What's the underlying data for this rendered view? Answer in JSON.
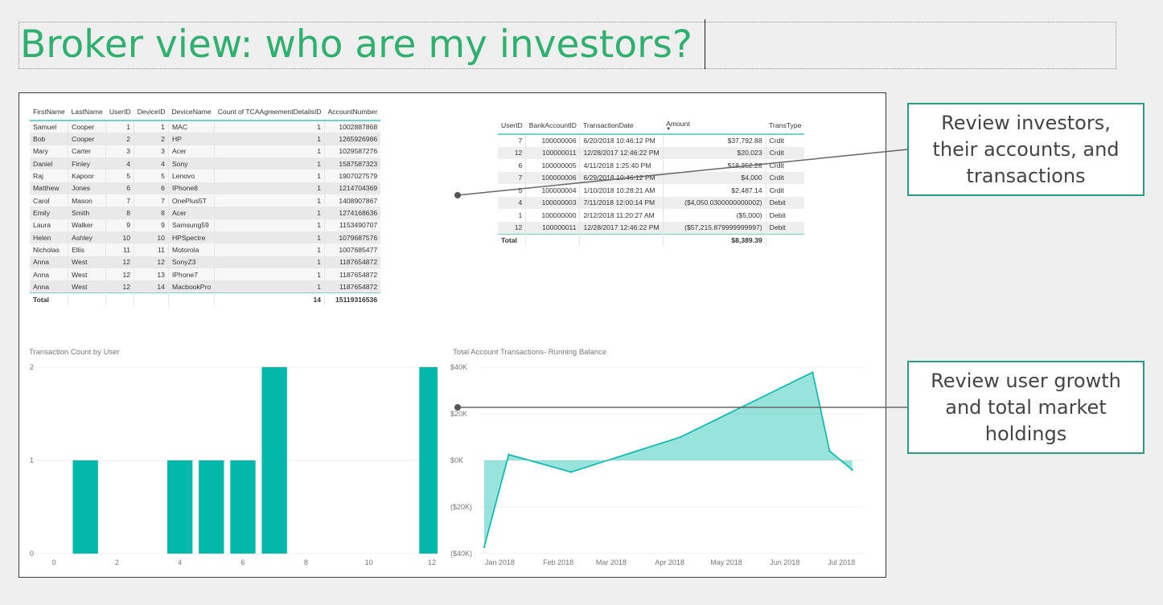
{
  "slide": {
    "title": "Broker view: who are my investors?"
  },
  "investors_table": {
    "columns": [
      "FirstName",
      "LastName",
      "UserID",
      "DeviceID",
      "DeviceName",
      "Count of TCAAgreementDetailsID",
      "AccountNumber"
    ],
    "rows": [
      [
        "Samuel",
        "Cooper",
        "1",
        "1",
        "MAC",
        "1",
        "1002887868"
      ],
      [
        "Bob",
        "Cooper",
        "2",
        "2",
        "HP",
        "1",
        "1265926986"
      ],
      [
        "Mary",
        "Carter",
        "3",
        "3",
        "Acer",
        "1",
        "1029587276"
      ],
      [
        "Daniel",
        "Finley",
        "4",
        "4",
        "Sony",
        "1",
        "1587587323"
      ],
      [
        "Raj",
        "Kapoor",
        "5",
        "5",
        "Lenovo",
        "1",
        "1907027579"
      ],
      [
        "Matthew",
        "Jones",
        "6",
        "6",
        "IPhone8",
        "1",
        "1214704369"
      ],
      [
        "Carol",
        "Mason",
        "7",
        "7",
        "OnePlus5T",
        "1",
        "1408907867"
      ],
      [
        "Emily",
        "Smith",
        "8",
        "8",
        "Acer",
        "1",
        "1274168636"
      ],
      [
        "Laura",
        "Walker",
        "9",
        "9",
        "Samsung59",
        "1",
        "1153490707"
      ],
      [
        "Helen",
        "Ashley",
        "10",
        "10",
        "HPSpectre",
        "1",
        "1079687576"
      ],
      [
        "Nicholas",
        "Ellis",
        "11",
        "11",
        "Motorola",
        "1",
        "1007685477"
      ],
      [
        "Anna",
        "West",
        "12",
        "12",
        "SonyZ3",
        "1",
        "1187654872"
      ],
      [
        "Anna",
        "West",
        "12",
        "13",
        "IPhone7",
        "1",
        "1187654872"
      ],
      [
        "Anna",
        "West",
        "12",
        "14",
        "MacbookPro",
        "1",
        "1187654872"
      ]
    ],
    "total": {
      "label": "Total",
      "count": "14",
      "account": "15119316536"
    }
  },
  "transactions_table": {
    "columns": [
      "UserID",
      "BankAccountID",
      "TransactionDate",
      "Amount",
      "TransType"
    ],
    "rows": [
      [
        "7",
        "100000006",
        "6/20/2018 10:46:12 PM",
        "$37,792.88",
        "Crdit"
      ],
      [
        "12",
        "100000011",
        "12/28/2017 12:46:22 PM",
        "$20,023",
        "Crdit"
      ],
      [
        "6",
        "100000005",
        "4/11/2018 1:25:40 PM",
        "$18,352.28",
        "Crdit"
      ],
      [
        "7",
        "100000006",
        "6/29/2018 10:46:12 PM",
        "$4,000",
        "Crdit"
      ],
      [
        "5",
        "100000004",
        "1/10/2018 10:28:21 AM",
        "$2,487.14",
        "Crdit"
      ],
      [
        "4",
        "100000003",
        "7/11/2018 12:00:14 PM",
        "($4,050.0300000000002)",
        "Debit"
      ],
      [
        "1",
        "100000000",
        "2/12/2018 11:20:27 AM",
        "($5,000)",
        "Debit"
      ],
      [
        "12",
        "100000011",
        "12/28/2017 12:46:22 PM",
        "($57,215.879999999997)",
        "Debit"
      ]
    ],
    "total": {
      "label": "Total",
      "amount": "$8,389.39"
    }
  },
  "callouts": {
    "first": [
      "Review investors,",
      "their accounts, and",
      "transactions"
    ],
    "second": [
      "Review user growth",
      "and total market",
      "holdings"
    ]
  },
  "colors": {
    "accent": "#01b8aa",
    "title": "#2fb06e",
    "callout_border": "#2a9c86"
  },
  "chart_data": [
    {
      "type": "bar",
      "title": "Transaction Count by User",
      "xlabel": "",
      "ylabel": "",
      "x": [
        1,
        4,
        5,
        6,
        7,
        12
      ],
      "values": [
        1,
        1,
        1,
        1,
        2,
        2
      ],
      "xticks": [
        "0",
        "2",
        "4",
        "6",
        "8",
        "10",
        "12"
      ],
      "yticks": [
        "0",
        "1",
        "2"
      ],
      "xlim": [
        0,
        12
      ],
      "ylim": [
        0,
        2
      ],
      "color": "#01b8aa",
      "grid": true
    },
    {
      "type": "area",
      "title": "Total Account Transactions- Running Balance",
      "xlabel": "",
      "ylabel": "",
      "x": [
        "2017-12-28",
        "2018-01-10",
        "2018-02-12",
        "2018-04-11",
        "2018-06-20",
        "2018-06-29",
        "2018-07-11"
      ],
      "values": [
        -37193,
        2487,
        -5000,
        10000,
        37793,
        4000,
        -4050
      ],
      "xticks": [
        "Jan 2018",
        "Feb 2018",
        "Mar 2018",
        "Apr 2018",
        "May 2018",
        "Jun 2018",
        "Jul 2018"
      ],
      "yticks": [
        "$40K",
        "$20K",
        "$0K",
        "($20K)",
        "($40K)"
      ],
      "ylim": [
        -40000,
        40000
      ],
      "color": "#01b8aa",
      "grid": true
    }
  ]
}
